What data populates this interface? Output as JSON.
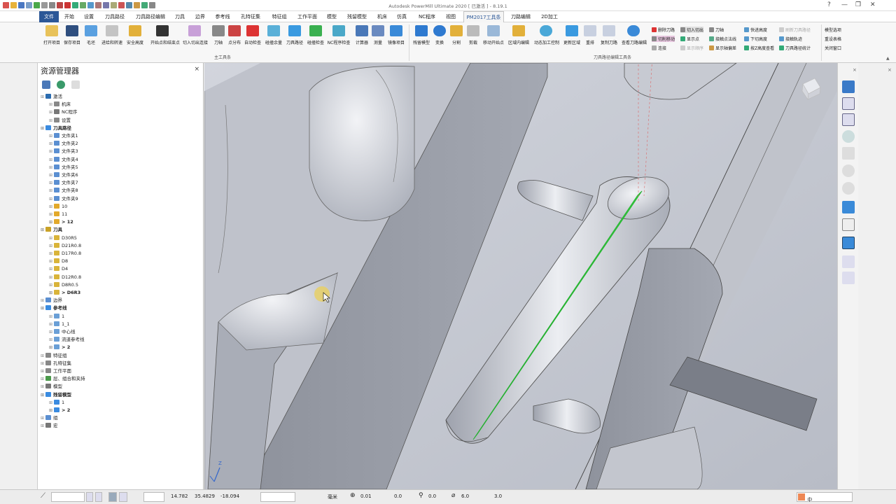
{
  "window": {
    "title": "Autodesk PowerMill Ultimate 2020    [ 已激活 ] - 8.19.1"
  },
  "menu": {
    "tabs": [
      "文件",
      "开始",
      "设置",
      "刀具路径",
      "刀具路径编辑",
      "刀具",
      "边界",
      "参考线",
      "孔特征集",
      "特征组",
      "工作平面",
      "模型",
      "残留模型",
      "机床",
      "仿真",
      "NC程序",
      "视图",
      "PM2017工具条",
      "刀路编辑",
      "2D加工"
    ]
  },
  "ribbon": {
    "main_buttons": [
      "打开项目",
      "保存项目",
      "毛坯",
      "进给和转速",
      "安全高度",
      "开始点和结束点",
      "切入切出连接",
      "刀轴",
      "点分布",
      "自动检查",
      "碰撞余量",
      "刀具路径",
      "碰撞检查",
      "NC程序检查",
      "计算器",
      "测量",
      "镜像项目"
    ],
    "edit_buttons": [
      "残留模型",
      "变换",
      "分割",
      "剪裁",
      "移动开始点",
      "区域内编辑",
      "动态加工控制",
      "更新区域",
      "重排",
      "复制刀路",
      "查看刀路编辑"
    ],
    "small_col1": [
      "删除刀路",
      "切削移动",
      "连接"
    ],
    "small_col2": [
      "切入切出",
      "显示点",
      "显示顺序"
    ],
    "small_col3": [
      "刀轴",
      "接触点法线",
      "显示轴偏差"
    ],
    "small_col4": [
      "快进高度",
      "下切高度",
      "按Z高度查看"
    ],
    "small_col5": [
      "刷新刀具路径",
      "接触轨迹",
      "刀具路径统计"
    ],
    "small_col6": [
      "模型选项",
      "重设表格",
      "关闭窗口"
    ],
    "group_main": "主工具条",
    "group_edit": "刀具路径编辑工具条"
  },
  "explorer": {
    "title": "资源管理器",
    "close": "×",
    "items": [
      {
        "label": "激活",
        "ind": 0,
        "col": "#2b6cb0",
        "bold": false
      },
      {
        "label": "机床",
        "ind": 1,
        "col": "#888",
        "bold": false
      },
      {
        "label": "NC程序",
        "ind": 1,
        "col": "#777",
        "bold": false
      },
      {
        "label": "设置",
        "ind": 1,
        "col": "#888",
        "bold": false
      },
      {
        "label": "刀具路径",
        "ind": 0,
        "col": "#3a8be0",
        "bold": true
      },
      {
        "label": "文件夹1",
        "ind": 1,
        "col": "#5b8fd1",
        "bold": false
      },
      {
        "label": "文件夹2",
        "ind": 1,
        "col": "#5b8fd1",
        "bold": false
      },
      {
        "label": "文件夹3",
        "ind": 1,
        "col": "#5b8fd1",
        "bold": false
      },
      {
        "label": "文件夹4",
        "ind": 1,
        "col": "#5b8fd1",
        "bold": false
      },
      {
        "label": "文件夹5",
        "ind": 1,
        "col": "#5b8fd1",
        "bold": false
      },
      {
        "label": "文件夹6",
        "ind": 1,
        "col": "#5b8fd1",
        "bold": false
      },
      {
        "label": "文件夹7",
        "ind": 1,
        "col": "#5b8fd1",
        "bold": false
      },
      {
        "label": "文件夹8",
        "ind": 1,
        "col": "#5b8fd1",
        "bold": false
      },
      {
        "label": "文件夹9",
        "ind": 1,
        "col": "#5b8fd1",
        "bold": false
      },
      {
        "label": "10",
        "ind": 1,
        "col": "#e2a92b",
        "bold": false
      },
      {
        "label": "11",
        "ind": 1,
        "col": "#e2a92b",
        "bold": false
      },
      {
        "label": "> 12",
        "ind": 1,
        "col": "#e2a92b",
        "bold": true
      },
      {
        "label": "刀具",
        "ind": 0,
        "col": "#c9a227",
        "bold": true
      },
      {
        "label": "D30R5",
        "ind": 1,
        "col": "#d9b43a",
        "bold": false
      },
      {
        "label": "D21R0.8",
        "ind": 1,
        "col": "#d9b43a",
        "bold": false
      },
      {
        "label": "D17R0.8",
        "ind": 1,
        "col": "#d9b43a",
        "bold": false
      },
      {
        "label": "D8",
        "ind": 1,
        "col": "#d9b43a",
        "bold": false
      },
      {
        "label": "D4",
        "ind": 1,
        "col": "#d9b43a",
        "bold": false
      },
      {
        "label": "D12R0.8",
        "ind": 1,
        "col": "#d9b43a",
        "bold": false
      },
      {
        "label": "D8R0.5",
        "ind": 1,
        "col": "#d9b43a",
        "bold": false
      },
      {
        "label": "> D6R3",
        "ind": 1,
        "col": "#d9b43a",
        "bold": true
      },
      {
        "label": "边界",
        "ind": 0,
        "col": "#5b8fd1",
        "bold": false
      },
      {
        "label": "参考线",
        "ind": 0,
        "col": "#3a8be0",
        "bold": true
      },
      {
        "label": "1",
        "ind": 1,
        "col": "#6a9fd6",
        "bold": false
      },
      {
        "label": "1_1",
        "ind": 1,
        "col": "#6a9fd6",
        "bold": false
      },
      {
        "label": "中心线",
        "ind": 1,
        "col": "#6a9fd6",
        "bold": false
      },
      {
        "label": "流道参考线",
        "ind": 1,
        "col": "#6a9fd6",
        "bold": false
      },
      {
        "label": "> 2",
        "ind": 1,
        "col": "#6a9fd6",
        "bold": true
      },
      {
        "label": "特征组",
        "ind": 0,
        "col": "#888",
        "bold": false
      },
      {
        "label": "孔特征集",
        "ind": 0,
        "col": "#888",
        "bold": false
      },
      {
        "label": "工作平面",
        "ind": 0,
        "col": "#888",
        "bold": false
      },
      {
        "label": "层、组合和夹持",
        "ind": 0,
        "col": "#4a9a4a",
        "bold": false
      },
      {
        "label": "模型",
        "ind": 0,
        "col": "#777",
        "bold": false
      },
      {
        "label": "残留模型",
        "ind": 0,
        "col": "#3a8be0",
        "bold": true
      },
      {
        "label": "1",
        "ind": 1,
        "col": "#3a8be0",
        "bold": false
      },
      {
        "label": "> 2",
        "ind": 1,
        "col": "#3a8be0",
        "bold": true
      },
      {
        "label": "组",
        "ind": 0,
        "col": "#5b8fd1",
        "bold": false
      },
      {
        "label": "宏",
        "ind": 0,
        "col": "#777",
        "bold": false
      }
    ]
  },
  "statusbar": {
    "coord_x": "14.782",
    "coord_y": "35.4829",
    "coord_z": "-18.094",
    "units": "毫米",
    "tolerance": "0.01",
    "thickness": "0.0",
    "radial": "0.0",
    "diameter": "6.0",
    "stepover": "3.0",
    "colors": {
      "accent": "#2b5797",
      "toolpath": "#3ddc47"
    }
  },
  "viewport": {
    "axis_label": "Z"
  }
}
